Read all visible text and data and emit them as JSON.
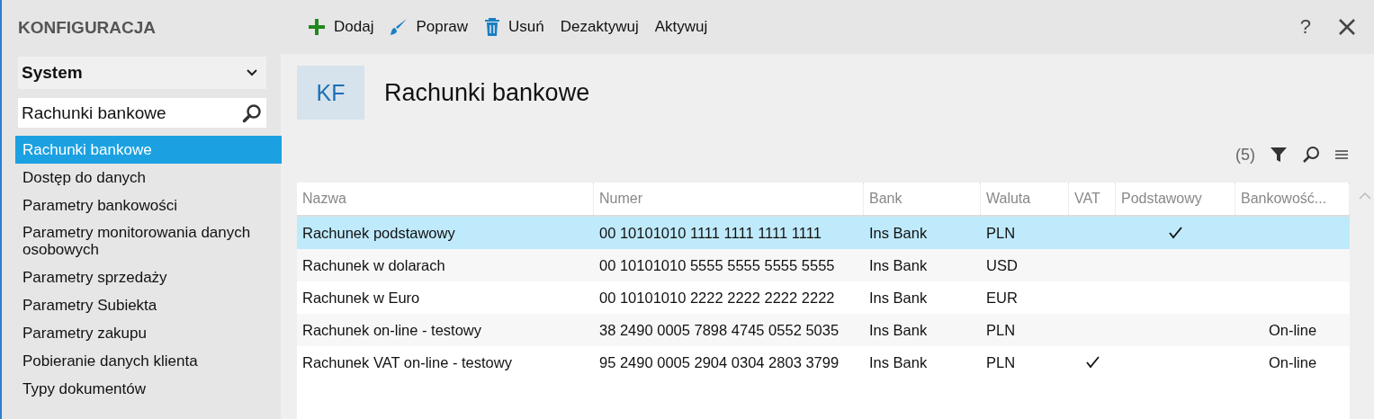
{
  "sidebar": {
    "title": "KONFIGURACJA",
    "module_select": {
      "value": "System"
    },
    "search": {
      "value": "Rachunki bankowe"
    },
    "items": [
      {
        "label": "Rachunki bankowe",
        "selected": true
      },
      {
        "label": "Dostęp do danych",
        "selected": false
      },
      {
        "label": "Parametry bankowości",
        "selected": false
      },
      {
        "label": "Parametry monitorowania danych osobowych",
        "selected": false
      },
      {
        "label": "Parametry sprzedaży",
        "selected": false
      },
      {
        "label": "Parametry Subiekta",
        "selected": false
      },
      {
        "label": "Parametry zakupu",
        "selected": false
      },
      {
        "label": "Pobieranie danych klienta",
        "selected": false
      },
      {
        "label": "Typy dokumentów",
        "selected": false
      }
    ]
  },
  "toolbar": [
    {
      "kind": "add",
      "label": "Dodaj"
    },
    {
      "kind": "edit",
      "label": "Popraw"
    },
    {
      "kind": "delete",
      "label": "Usuń"
    },
    {
      "kind": "plain",
      "label": "Dezaktywuj"
    },
    {
      "kind": "plain",
      "label": "Aktywuj"
    }
  ],
  "help": "?",
  "page": {
    "badge": "KF",
    "title": "Rachunki bankowe",
    "count": "(5)"
  },
  "table": {
    "columns": [
      "Nazwa",
      "Numer",
      "Bank",
      "Waluta",
      "VAT",
      "Podstawowy",
      "Bankowość..."
    ],
    "rows": [
      {
        "name": "Rachunek podstawowy",
        "number": "00 10101010 1111 1111 1111 1111",
        "bank": "Ins Bank",
        "currency": "PLN",
        "vat": false,
        "primary": true,
        "selected": true
      },
      {
        "name": "Rachunek w dolarach",
        "number": "00 10101010 5555 5555 5555 5555",
        "bank": "Ins Bank",
        "currency": "USD",
        "vat": false,
        "primary": false,
        "selected": false
      },
      {
        "name": "Rachunek w Euro",
        "number": "00 10101010 2222 2222 2222 2222",
        "bank": "Ins Bank",
        "currency": "EUR",
        "vat": false,
        "primary": false,
        "selected": false
      },
      {
        "name": "Rachunek on-line - testowy",
        "number": "38 2490 0005 7898 4745 0552 5035",
        "bank": "Ins Bank",
        "currency": "PLN",
        "vat": false,
        "primary": false,
        "banking": "On-line",
        "selected": false
      },
      {
        "name": "Rachunek VAT on-line - testowy",
        "number": "95 2490 0005 2904 0304 2803 3799",
        "bank": "Ins Bank",
        "currency": "PLN",
        "vat": true,
        "primary": false,
        "banking": "On-line",
        "selected": false
      }
    ]
  }
}
